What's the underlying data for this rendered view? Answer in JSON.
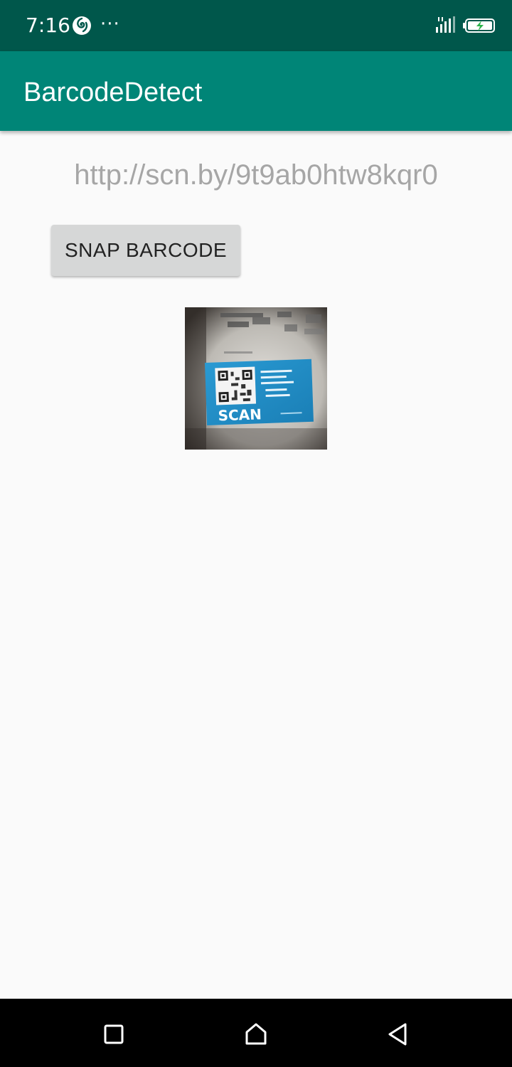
{
  "status_bar": {
    "time": "7:16",
    "more": "···",
    "icons": [
      "app-notification-icon",
      "signal-icon",
      "battery-charging-icon"
    ]
  },
  "app_bar": {
    "title": "BarcodeDetect"
  },
  "content": {
    "result_text": "http://scn.by/9t9ab0htw8kqr0",
    "snap_button_label": "SNAP BARCODE",
    "photo": {
      "caption_text": "SCAN"
    }
  },
  "nav_bar": {
    "icons": [
      "recents-icon",
      "home-icon",
      "back-icon"
    ]
  },
  "colors": {
    "status_bar": "#00574B",
    "app_bar": "#008577",
    "background": "#FAFAFA",
    "button": "#D6D7D7",
    "result_text": "#A6A6A6",
    "card_blue": "#1E8FC8"
  }
}
